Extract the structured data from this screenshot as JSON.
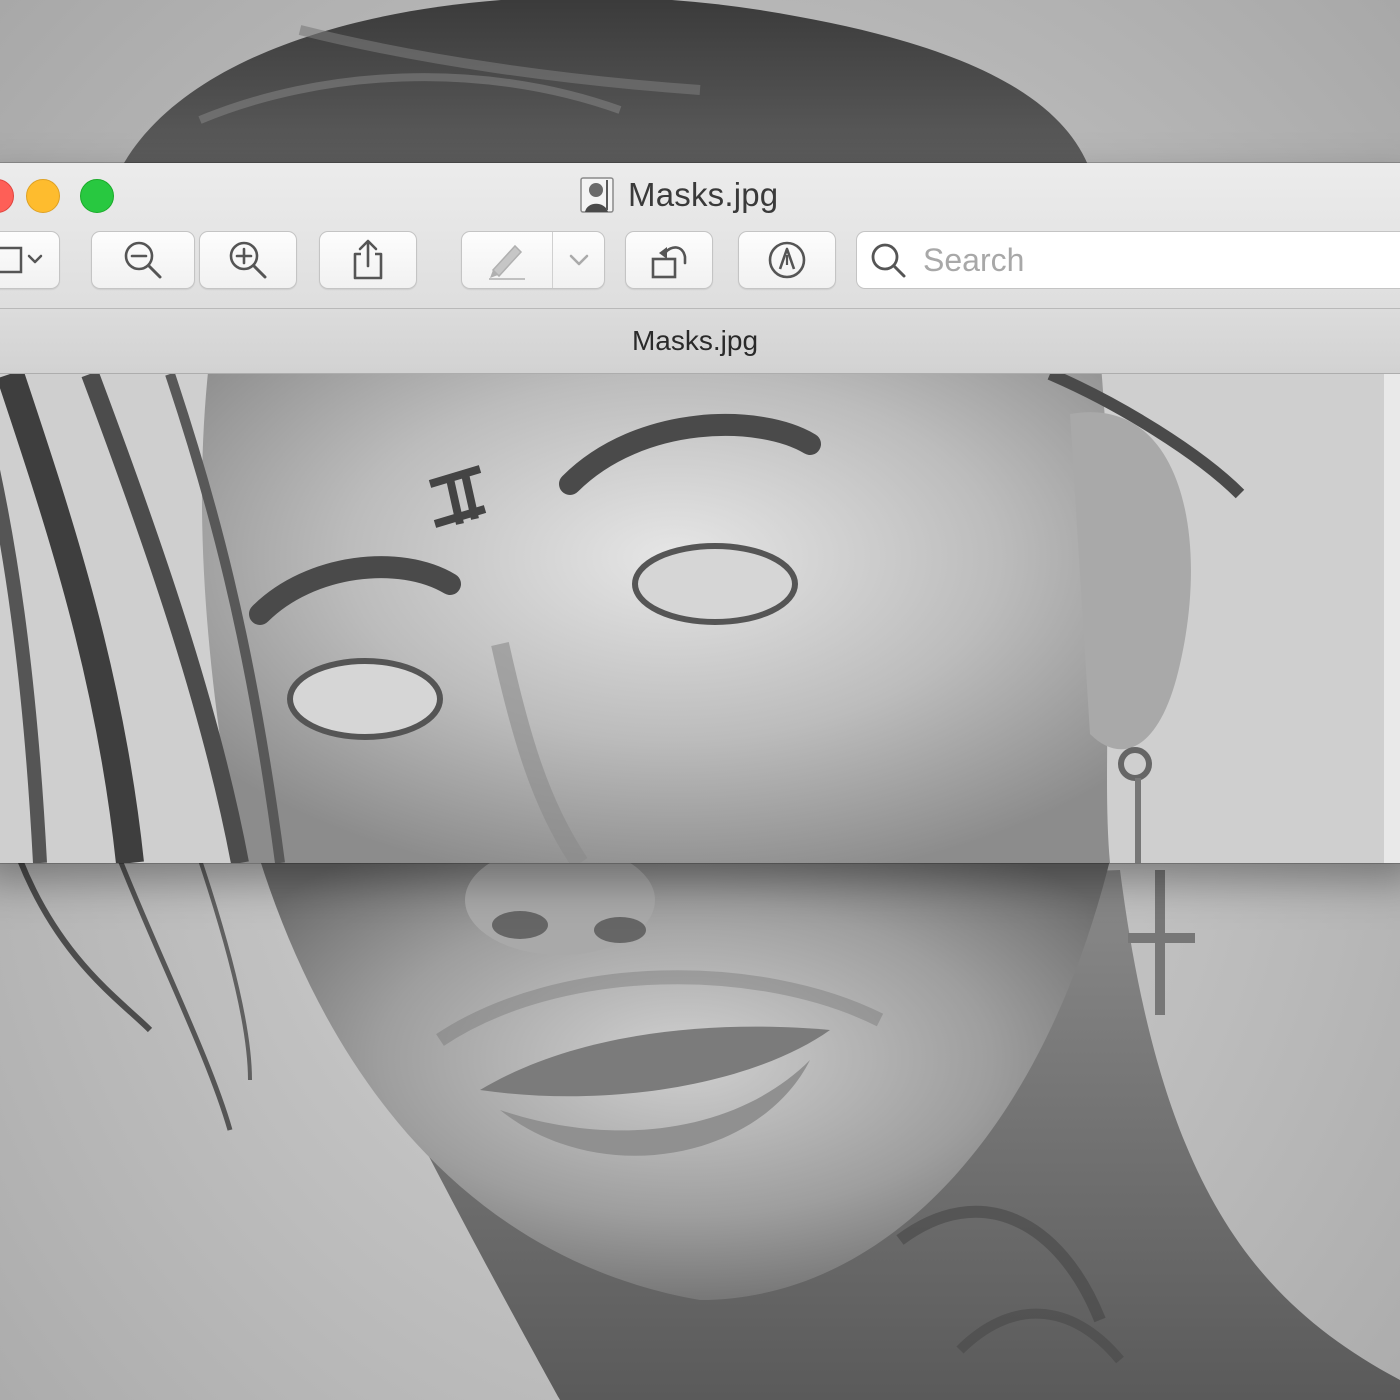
{
  "window": {
    "title": "Masks.jpg",
    "tab_title": "Masks.jpg"
  },
  "toolbar": {
    "buttons": [
      {
        "name": "view-menu-button",
        "icon": "sidebar-view-icon"
      },
      {
        "name": "zoom-out-button",
        "icon": "zoom-out-icon"
      },
      {
        "name": "zoom-in-button",
        "icon": "zoom-in-icon"
      },
      {
        "name": "share-button",
        "icon": "share-icon"
      },
      {
        "name": "markup-button",
        "icon": "pen-icon"
      },
      {
        "name": "rotate-button",
        "icon": "rotate-left-icon"
      },
      {
        "name": "annotate-button",
        "icon": "markup-circle-icon"
      }
    ]
  },
  "search": {
    "placeholder": "Search",
    "value": ""
  },
  "colors": {
    "close": "#fe5f57",
    "minimize": "#febc2e",
    "maximize": "#28c840",
    "titlebar": "#e4e4e4"
  }
}
